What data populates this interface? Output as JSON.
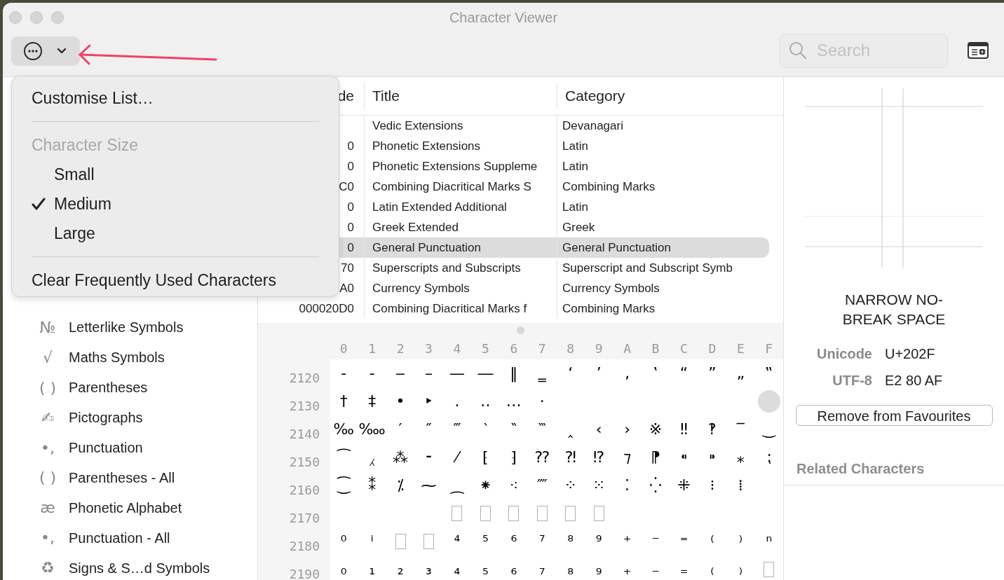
{
  "window": {
    "title": "Character Viewer"
  },
  "toolbar": {
    "search": {
      "placeholder": "Search"
    }
  },
  "menu": {
    "items": [
      {
        "kind": "action",
        "label": "Customise List…"
      },
      {
        "kind": "separator"
      },
      {
        "kind": "header",
        "label": "Character Size"
      },
      {
        "kind": "option",
        "label": "Small",
        "checked": false
      },
      {
        "kind": "option",
        "label": "Medium",
        "checked": true
      },
      {
        "kind": "option",
        "label": "Large",
        "checked": false
      },
      {
        "kind": "separator"
      },
      {
        "kind": "action",
        "label": "Clear Frequently Used Characters"
      }
    ]
  },
  "sidebar": {
    "items": [
      {
        "icon": "№",
        "label": "Letterlike Symbols"
      },
      {
        "icon": "√",
        "label": "Maths Symbols"
      },
      {
        "icon": "( )",
        "label": "Parentheses"
      },
      {
        "icon": "✍",
        "label": "Pictographs"
      },
      {
        "icon": "•,",
        "label": "Punctuation"
      },
      {
        "icon": "( )",
        "label": "Parentheses - All"
      },
      {
        "icon": "æ",
        "label": "Phonetic Alphabet"
      },
      {
        "icon": "•,",
        "label": "Punctuation - All"
      },
      {
        "icon": "♻",
        "label": "Signs & S…d Symbols"
      }
    ]
  },
  "table": {
    "columns": [
      "de",
      "Title",
      "Category"
    ],
    "rows": [
      {
        "title": "Vedic Extensions",
        "category": "Devanagari",
        "selected": false
      },
      {
        "code": "0",
        "title": "Phonetic Extensions",
        "category": "Latin",
        "selected": false
      },
      {
        "code": "0",
        "title": "Phonetic Extensions Suppleme",
        "category": "Latin",
        "selected": false
      },
      {
        "code": "C0",
        "title": "Combining Diacritical Marks S",
        "category": "Combining Marks",
        "selected": false
      },
      {
        "code": "0",
        "title": "Latin Extended Additional",
        "category": "Latin",
        "selected": false
      },
      {
        "code": "0",
        "title": "Greek Extended",
        "category": "Greek",
        "selected": false
      },
      {
        "code": "0",
        "title": "General Punctuation",
        "category": "General Punctuation",
        "selected": true
      },
      {
        "code": "70",
        "title": "Superscripts and Subscripts",
        "category": "Superscript and Subscript Symb",
        "selected": false
      },
      {
        "code": "A0",
        "title": "Currency Symbols",
        "category": "Currency Symbols",
        "selected": false
      },
      {
        "code": "000020D0",
        "title": "Combining Diacritical Marks f",
        "category": "Combining Marks",
        "selected": false
      }
    ]
  },
  "grid": {
    "columns": [
      "0",
      "1",
      "2",
      "3",
      "4",
      "5",
      "6",
      "7",
      "8",
      "9",
      "A",
      "B",
      "C",
      "D",
      "E",
      "F"
    ],
    "rows": [
      {
        "label": "2120",
        "cells": [
          {
            "kind": "glyph",
            "glyph": "‐",
            "selected": false
          },
          {
            "kind": "glyph",
            "glyph": "‑",
            "selected": false
          },
          {
            "kind": "glyph",
            "glyph": "‒",
            "selected": false
          },
          {
            "kind": "glyph",
            "glyph": "–",
            "selected": false
          },
          {
            "kind": "glyph",
            "glyph": "—",
            "selected": false
          },
          {
            "kind": "glyph",
            "glyph": "―",
            "selected": false
          },
          {
            "kind": "glyph",
            "glyph": "‖",
            "selected": false
          },
          {
            "kind": "glyph",
            "glyph": "‗",
            "selected": false
          },
          {
            "kind": "glyph",
            "glyph": "‘",
            "selected": false
          },
          {
            "kind": "glyph",
            "glyph": "’",
            "selected": false
          },
          {
            "kind": "glyph",
            "glyph": "‚",
            "selected": false
          },
          {
            "kind": "glyph",
            "glyph": "‛",
            "selected": false
          },
          {
            "kind": "glyph",
            "glyph": "“",
            "selected": false
          },
          {
            "kind": "glyph",
            "glyph": "”",
            "selected": false
          },
          {
            "kind": "glyph",
            "glyph": "„",
            "selected": false
          },
          {
            "kind": "glyph",
            "glyph": "‟",
            "selected": false
          }
        ]
      },
      {
        "label": "2130",
        "cells": [
          {
            "kind": "glyph",
            "glyph": "†",
            "selected": false
          },
          {
            "kind": "glyph",
            "glyph": "‡",
            "selected": false
          },
          {
            "kind": "glyph",
            "glyph": "•",
            "selected": false
          },
          {
            "kind": "glyph",
            "glyph": "‣",
            "selected": false
          },
          {
            "kind": "glyph",
            "glyph": "․",
            "selected": false
          },
          {
            "kind": "glyph",
            "glyph": "‥",
            "selected": false
          },
          {
            "kind": "glyph",
            "glyph": "…",
            "selected": false
          },
          {
            "kind": "glyph",
            "glyph": "‧",
            "selected": false
          },
          {
            "kind": "blank",
            "selected": false
          },
          {
            "kind": "blank",
            "selected": false
          },
          {
            "kind": "blank",
            "selected": false
          },
          {
            "kind": "blank",
            "selected": false
          },
          {
            "kind": "blank",
            "selected": false
          },
          {
            "kind": "blank",
            "selected": false
          },
          {
            "kind": "blank",
            "selected": false
          },
          {
            "kind": "blank",
            "selected": true
          }
        ]
      },
      {
        "label": "2140",
        "cells": [
          {
            "kind": "glyph",
            "glyph": "‰",
            "selected": false
          },
          {
            "kind": "glyph",
            "glyph": "‱",
            "selected": false
          },
          {
            "kind": "glyph",
            "glyph": "′",
            "selected": false
          },
          {
            "kind": "glyph",
            "glyph": "″",
            "selected": false
          },
          {
            "kind": "glyph",
            "glyph": "‴",
            "selected": false
          },
          {
            "kind": "glyph",
            "glyph": "‵",
            "selected": false
          },
          {
            "kind": "glyph",
            "glyph": "‶",
            "selected": false
          },
          {
            "kind": "glyph",
            "glyph": "‷",
            "selected": false
          },
          {
            "kind": "glyph",
            "glyph": "‸",
            "selected": false
          },
          {
            "kind": "glyph",
            "glyph": "‹",
            "selected": false
          },
          {
            "kind": "glyph",
            "glyph": "›",
            "selected": false
          },
          {
            "kind": "glyph",
            "glyph": "※",
            "selected": false
          },
          {
            "kind": "glyph",
            "glyph": "‼",
            "selected": false
          },
          {
            "kind": "glyph",
            "glyph": "‽",
            "selected": false
          },
          {
            "kind": "glyph",
            "glyph": "‾",
            "selected": false
          },
          {
            "kind": "glyph",
            "glyph": "‿",
            "selected": false
          }
        ]
      },
      {
        "label": "2150",
        "cells": [
          {
            "kind": "glyph",
            "glyph": "⁀",
            "selected": false
          },
          {
            "kind": "glyph",
            "glyph": "⁁",
            "selected": false
          },
          {
            "kind": "glyph",
            "glyph": "⁂",
            "selected": false
          },
          {
            "kind": "glyph",
            "glyph": "⁃",
            "selected": false
          },
          {
            "kind": "glyph",
            "glyph": "⁄",
            "selected": false
          },
          {
            "kind": "glyph",
            "glyph": "⁅",
            "selected": false
          },
          {
            "kind": "glyph",
            "glyph": "⁆",
            "selected": false
          },
          {
            "kind": "glyph",
            "glyph": "⁇",
            "selected": false
          },
          {
            "kind": "glyph",
            "glyph": "⁈",
            "selected": false
          },
          {
            "kind": "glyph",
            "glyph": "⁉",
            "selected": false
          },
          {
            "kind": "glyph",
            "glyph": "⁊",
            "selected": false
          },
          {
            "kind": "glyph",
            "glyph": "⁋",
            "selected": false
          },
          {
            "kind": "glyph",
            "glyph": "⁌",
            "selected": false
          },
          {
            "kind": "glyph",
            "glyph": "⁍",
            "selected": false
          },
          {
            "kind": "glyph",
            "glyph": "⁎",
            "selected": false
          },
          {
            "kind": "glyph",
            "glyph": "⁏",
            "selected": false
          }
        ]
      },
      {
        "label": "2160",
        "cells": [
          {
            "kind": "glyph",
            "glyph": "⁐",
            "selected": false
          },
          {
            "kind": "glyph",
            "glyph": "⁑",
            "selected": false
          },
          {
            "kind": "glyph",
            "glyph": "⁒",
            "selected": false
          },
          {
            "kind": "glyph",
            "glyph": "⁓",
            "selected": false
          },
          {
            "kind": "glyph",
            "glyph": "⁔",
            "selected": false
          },
          {
            "kind": "glyph",
            "glyph": "⁕",
            "selected": false
          },
          {
            "kind": "glyph",
            "glyph": "⁖",
            "selected": false
          },
          {
            "kind": "glyph",
            "glyph": "⁗",
            "selected": false
          },
          {
            "kind": "glyph",
            "glyph": "⁘",
            "selected": false
          },
          {
            "kind": "glyph",
            "glyph": "⁙",
            "selected": false
          },
          {
            "kind": "glyph",
            "glyph": "⁚",
            "selected": false
          },
          {
            "kind": "glyph",
            "glyph": "⁛",
            "selected": false
          },
          {
            "kind": "glyph",
            "glyph": "⁜",
            "selected": false
          },
          {
            "kind": "glyph",
            "glyph": "⁝",
            "selected": false
          },
          {
            "kind": "glyph",
            "glyph": "⁞",
            "selected": false
          },
          {
            "kind": "blank",
            "selected": false
          }
        ]
      },
      {
        "label": "2170",
        "cells": [
          {
            "kind": "blank",
            "selected": false
          },
          {
            "kind": "blank",
            "selected": false
          },
          {
            "kind": "blank",
            "selected": false
          },
          {
            "kind": "blank",
            "selected": false
          },
          {
            "kind": "missing",
            "selected": false
          },
          {
            "kind": "missing",
            "selected": false
          },
          {
            "kind": "missing",
            "selected": false
          },
          {
            "kind": "missing",
            "selected": false
          },
          {
            "kind": "missing",
            "selected": false
          },
          {
            "kind": "missing",
            "selected": false
          },
          {
            "kind": "blank",
            "selected": false
          },
          {
            "kind": "blank",
            "selected": false
          },
          {
            "kind": "blank",
            "selected": false
          },
          {
            "kind": "blank",
            "selected": false
          },
          {
            "kind": "blank",
            "selected": false
          },
          {
            "kind": "blank",
            "selected": false
          }
        ]
      },
      {
        "label": "2180",
        "cells": [
          {
            "kind": "glyph",
            "glyph": "⁰",
            "selected": false
          },
          {
            "kind": "glyph",
            "glyph": "ⁱ",
            "selected": false
          },
          {
            "kind": "missing",
            "selected": false
          },
          {
            "kind": "missing",
            "selected": false
          },
          {
            "kind": "glyph",
            "glyph": "⁴",
            "selected": false
          },
          {
            "kind": "glyph",
            "glyph": "⁵",
            "selected": false
          },
          {
            "kind": "glyph",
            "glyph": "⁶",
            "selected": false
          },
          {
            "kind": "glyph",
            "glyph": "⁷",
            "selected": false
          },
          {
            "kind": "glyph",
            "glyph": "⁸",
            "selected": false
          },
          {
            "kind": "glyph",
            "glyph": "⁹",
            "selected": false
          },
          {
            "kind": "glyph",
            "glyph": "⁺",
            "selected": false
          },
          {
            "kind": "glyph",
            "glyph": "⁻",
            "selected": false
          },
          {
            "kind": "glyph",
            "glyph": "⁼",
            "selected": false
          },
          {
            "kind": "glyph",
            "glyph": "⁽",
            "selected": false
          },
          {
            "kind": "glyph",
            "glyph": "⁾",
            "selected": false
          },
          {
            "kind": "glyph",
            "glyph": "ⁿ",
            "selected": false
          }
        ]
      },
      {
        "label": "2190",
        "cells": [
          {
            "kind": "glyph",
            "glyph": "₀",
            "selected": false
          },
          {
            "kind": "glyph",
            "glyph": "₁",
            "selected": false
          },
          {
            "kind": "glyph",
            "glyph": "₂",
            "selected": false
          },
          {
            "kind": "glyph",
            "glyph": "₃",
            "selected": false
          },
          {
            "kind": "glyph",
            "glyph": "₄",
            "selected": false
          },
          {
            "kind": "glyph",
            "glyph": "₅",
            "selected": false
          },
          {
            "kind": "glyph",
            "glyph": "₆",
            "selected": false
          },
          {
            "kind": "glyph",
            "glyph": "₇",
            "selected": false
          },
          {
            "kind": "glyph",
            "glyph": "₈",
            "selected": false
          },
          {
            "kind": "glyph",
            "glyph": "₉",
            "selected": false
          },
          {
            "kind": "glyph",
            "glyph": "₊",
            "selected": false
          },
          {
            "kind": "glyph",
            "glyph": "₋",
            "selected": false
          },
          {
            "kind": "glyph",
            "glyph": "₌",
            "selected": false
          },
          {
            "kind": "glyph",
            "glyph": "₍",
            "selected": false
          },
          {
            "kind": "glyph",
            "glyph": "₎",
            "selected": false
          },
          {
            "kind": "missing",
            "selected": false
          }
        ]
      }
    ]
  },
  "inspector": {
    "name": "NARROW NO-BREAK SPACE",
    "properties": [
      {
        "label": "Unicode",
        "value": "U+202F"
      },
      {
        "label": "UTF-8",
        "value": "E2 80 AF"
      }
    ],
    "button": "Remove from Favourites",
    "related_header": "Related Characters"
  }
}
